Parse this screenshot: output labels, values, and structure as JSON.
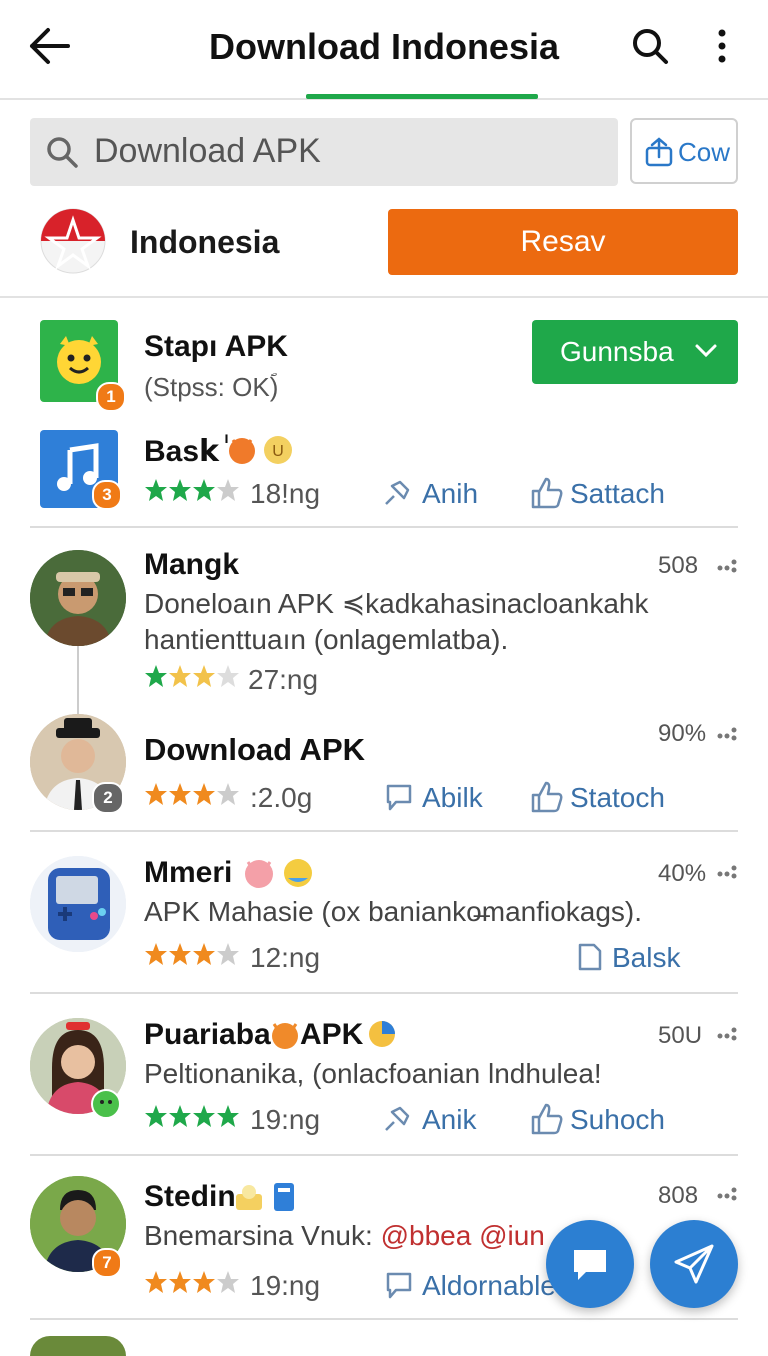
{
  "header": {
    "title": "Download Indonesia"
  },
  "search": {
    "placeholder": "Download APK"
  },
  "share_button": {
    "label": "Cow"
  },
  "country": {
    "name": "Indonesia",
    "button_label": "Resav"
  },
  "featured": [
    {
      "name": "Stapı APK",
      "subtitle": "(Stpss: OKؐ)",
      "badge": "1",
      "button_label": "Gunnsba"
    },
    {
      "name": "Baskٰ",
      "rating": "18!ng",
      "badge": "3",
      "action1": "Anih",
      "action2": "Sattach"
    }
  ],
  "list": [
    {
      "name": "Mangk",
      "meta": "508",
      "desc": "Doneloaın APK ≼kadkahasinacloankahk hantienttuaın (onlagemlatba).",
      "rating": "27:ng"
    },
    {
      "name": "Download APK",
      "meta": "90%",
      "rating": ":2.0g",
      "badge": "2",
      "action1": "Abilk",
      "action2": "Statoch"
    },
    {
      "name": "Mmeri",
      "meta": "40%",
      "desc": "APK Mahasie (ox banianko̶manfiokags).",
      "rating": "12:ng",
      "action2": "Balsk"
    },
    {
      "name": "Puariaba",
      "name_suffix": "APK",
      "meta": "50U",
      "desc": "Peltionanika, (onlacfoanian lndhulea!",
      "rating": "19:ng",
      "action1": "Anik",
      "action2": "Suhoch"
    },
    {
      "name": "Stedin",
      "meta": "808",
      "desc_prefix": "Bnemarsina Vnuk:",
      "desc_mentions": "@bbea @iun",
      "rating": "19:ng",
      "badge": "7",
      "action1": "Aldornable"
    }
  ],
  "colors": {
    "green": "#1fa84a",
    "orange": "#ec6a10",
    "blue_action": "#3a70a8",
    "fab": "#2c7fd2"
  }
}
